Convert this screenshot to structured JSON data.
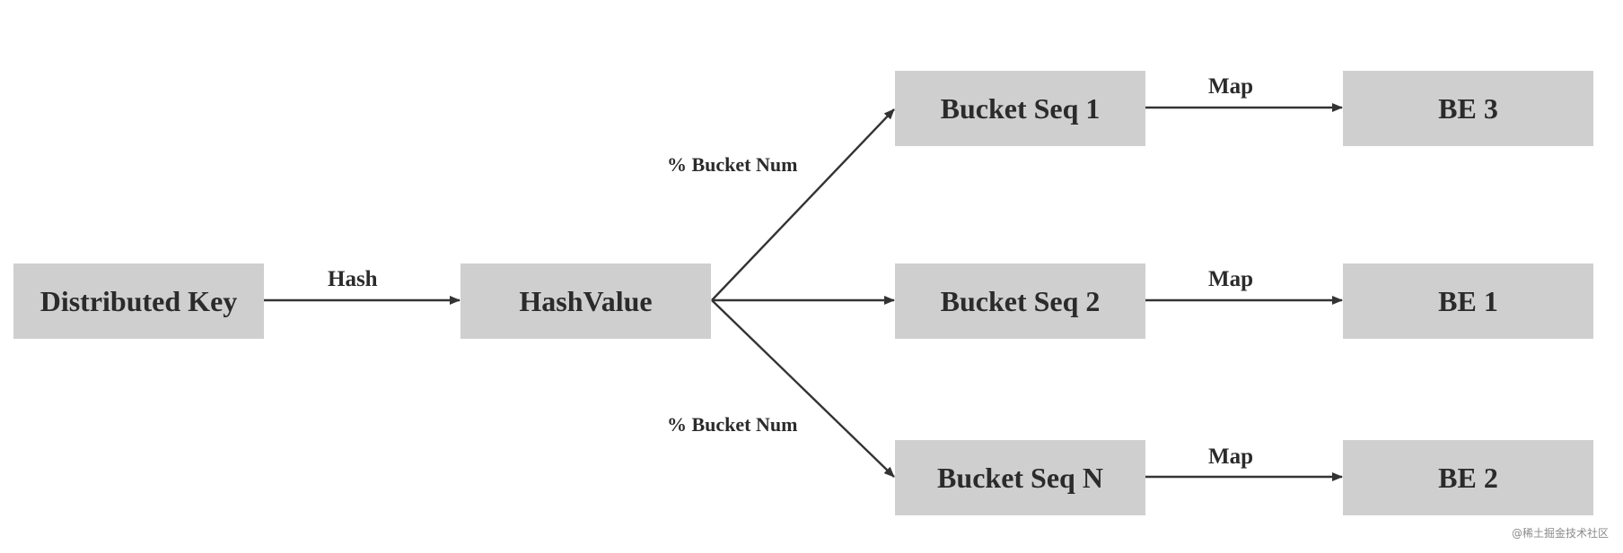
{
  "diagram": {
    "nodes": {
      "distributed_key": "Distributed Key",
      "hash_value": "HashValue",
      "bucket_seq_1": "Bucket Seq 1",
      "bucket_seq_2": "Bucket Seq 2",
      "bucket_seq_n": "Bucket Seq N",
      "be_3": "BE 3",
      "be_1": "BE 1",
      "be_2": "BE 2"
    },
    "edges": {
      "hash": "Hash",
      "bucket_num_top": "% Bucket Num",
      "bucket_num_bottom": "% Bucket Num",
      "map_1": "Map",
      "map_2": "Map",
      "map_n": "Map"
    },
    "colors": {
      "node_fill": "#cfcfcf",
      "edge": "#333333",
      "text": "#2b2b2b"
    }
  },
  "watermark": "@稀土掘金技术社区"
}
